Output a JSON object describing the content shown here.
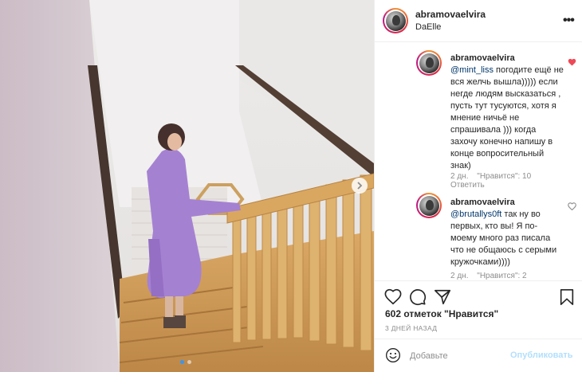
{
  "post": {
    "username": "abramovaelvira",
    "location": "DaElle",
    "more_icon": "more-horizontal-icon"
  },
  "comments": [
    {
      "username": "abramovaelvira",
      "mention": "@mint_liss",
      "text": " погодите ещё не вся желчь вышла))))) если негде людям высказаться , пусть тут тусуются, хотя я мнение ничьё не спрашивала ))) когда захочу конечно напишу в конце вопросительный знак)",
      "age": "2 дн.",
      "likes": "\"Нравится\": 10",
      "reply": "Ответить",
      "liked": true
    },
    {
      "username": "abramovaelvira",
      "mention": "@brutallys0ft",
      "text": " так ну во первых, кто вы! Я по-моему много раз писала что не общаюсь с серыми кружочками))))",
      "age": "2 дн.",
      "likes": "\"Нравится\": 2",
      "liked": false
    }
  ],
  "actions": {
    "likes_count": "602 отметок \"Нравится\"",
    "date": "3 ДНЕЙ НАЗАД"
  },
  "add_comment": {
    "placeholder": "Добавьте",
    "publish": "Опубликовать"
  },
  "carousel": {
    "current": 1,
    "total": 2
  },
  "colors": {
    "like_red": "#ed4956",
    "link_blue": "#00376b",
    "publish_disabled": "#b2dffc",
    "carousel_active": "#3897f0"
  }
}
